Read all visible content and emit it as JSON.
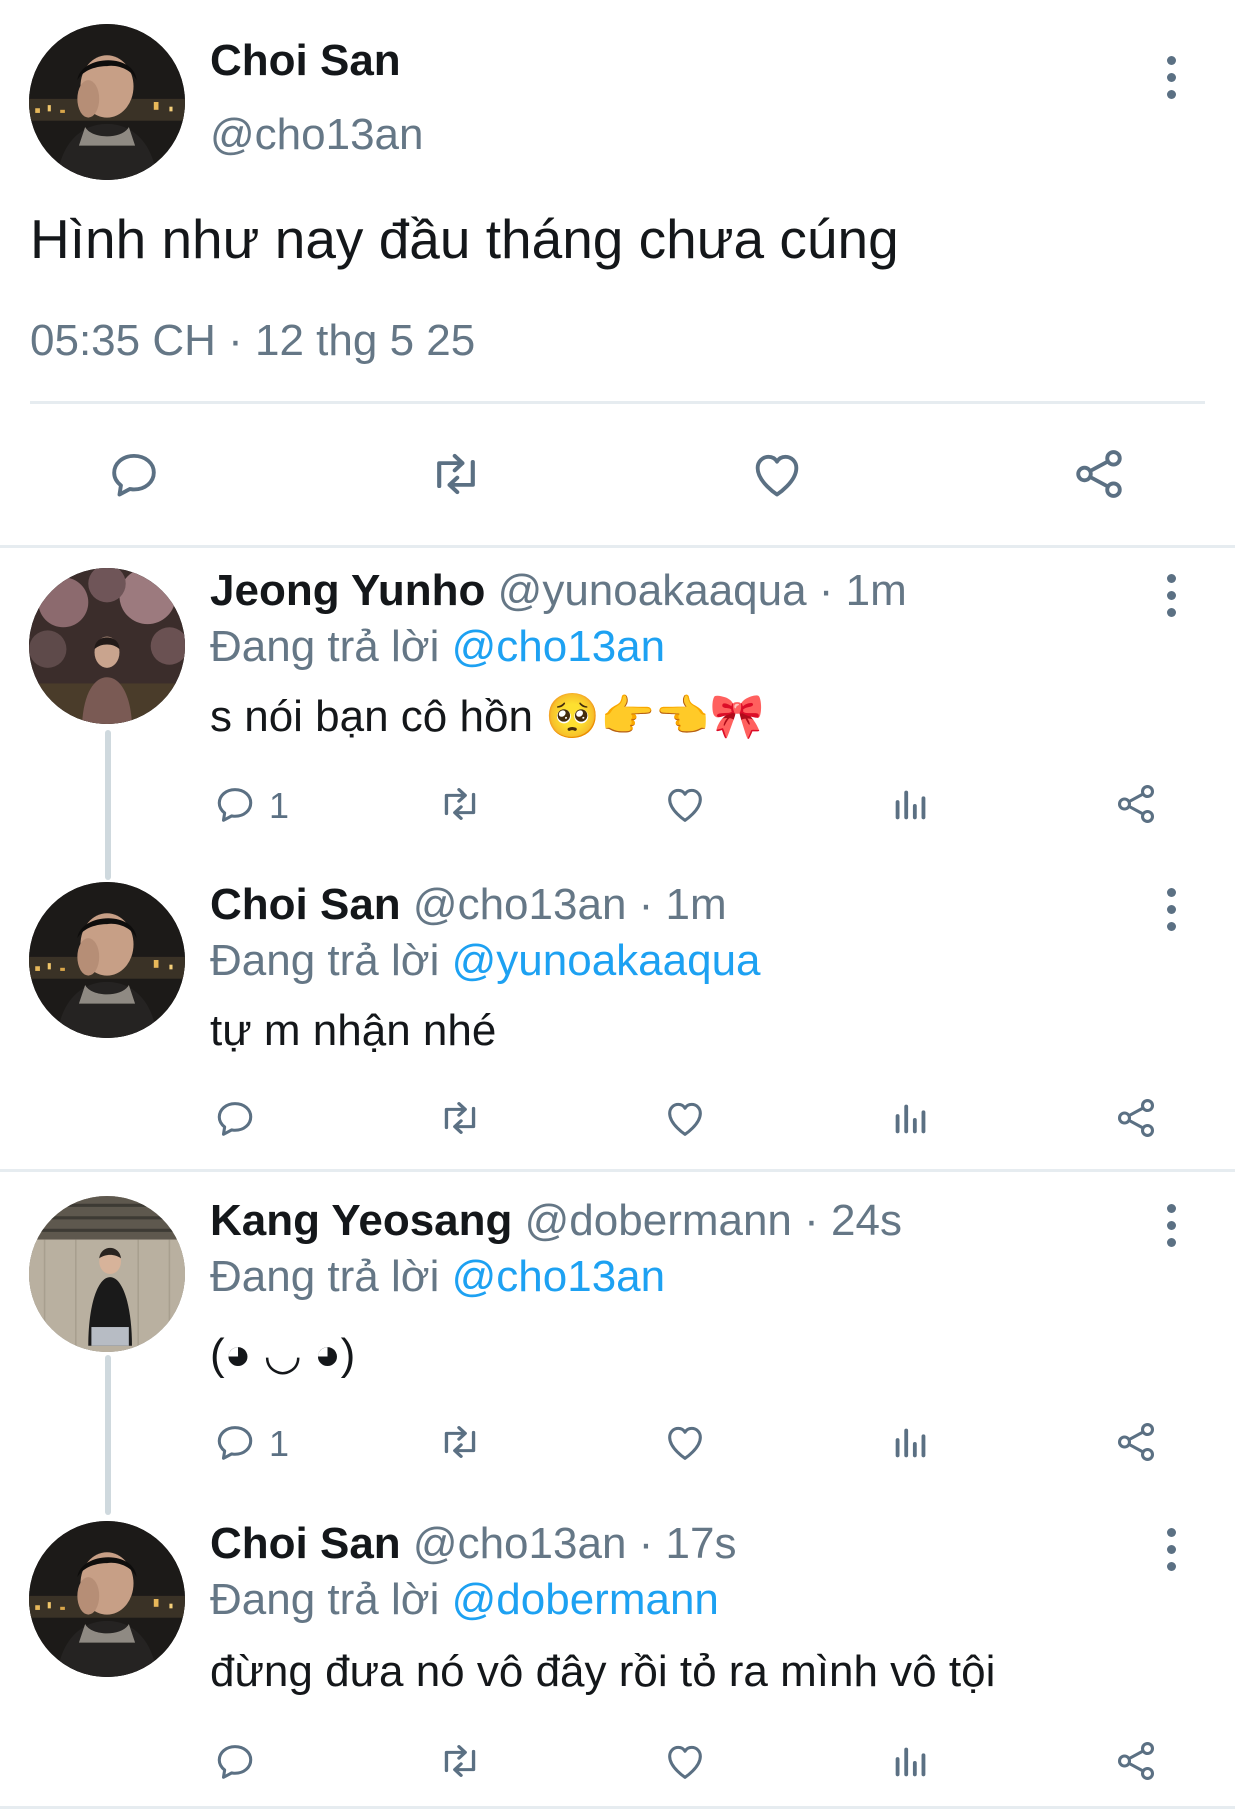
{
  "main_tweet": {
    "name": "Choi San",
    "handle": "@cho13an",
    "text": "Hình như nay đầu tháng chưa cúng",
    "time": "05:35 CH",
    "dot": "·",
    "date": "12 thg 5 25"
  },
  "replies": [
    {
      "name": "Jeong Yunho",
      "meta": "@yunoakaaqua · 1m",
      "replying_prefix": "Đang trả lời",
      "replying_to": "@cho13an",
      "text": "s nói bạn cô hồn",
      "emoji": "🥺👉👈🎀",
      "reply_count": "1"
    },
    {
      "name": "Choi San",
      "meta": "@cho13an · 1m",
      "replying_prefix": "Đang trả lời",
      "replying_to": "@yunoakaaqua",
      "text": "tự m nhận nhé",
      "emoji": "",
      "reply_count": ""
    },
    {
      "name": "Kang Yeosang",
      "meta": "@dobermann · 24s",
      "replying_prefix": "Đang trả lời",
      "replying_to": "@cho13an",
      "text": "(◕ ◡ ◕)",
      "emoji": "",
      "reply_count": "1"
    },
    {
      "name": "Choi San",
      "meta": "@cho13an · 17s",
      "replying_prefix": "Đang trả lời",
      "replying_to": "@dobermann",
      "text": "đừng đưa nó vô đây rồi tỏ ra mình vô tội",
      "emoji": "",
      "reply_count": ""
    }
  ],
  "icons": {
    "reply": "reply-icon",
    "retweet": "retweet-icon",
    "like": "heart-icon",
    "analytics": "analytics-icon",
    "share": "share-icon",
    "more": "more-options-icon"
  },
  "colors": {
    "link": "#1da1f2",
    "muted": "#657786",
    "icon": "#5b7083",
    "divider": "#e6ecf0"
  }
}
